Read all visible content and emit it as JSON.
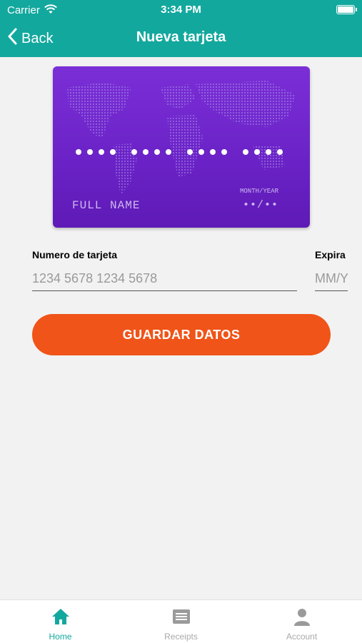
{
  "status": {
    "carrier": "Carrier",
    "time": "3:34 PM"
  },
  "nav": {
    "back_label": "Back",
    "title": "Nueva tarjeta"
  },
  "card": {
    "number_masked": [
      "●●●●",
      "●●●●",
      "●●●●",
      "●●●●"
    ],
    "full_name": "FULL NAME",
    "expiry_label": "MONTH/YEAR",
    "expiry_value": "••/••",
    "color_top": "#7a2fd6",
    "color_bottom": "#5e1ab6"
  },
  "form": {
    "number_label": "Numero de tarjeta",
    "number_placeholder": "1234 5678 1234 5678",
    "expiry_label": "Expira",
    "expiry_placeholder": "MM/YY"
  },
  "save_button": {
    "label": "GUARDAR DATOS",
    "color": "#f05418"
  },
  "tabbar": {
    "accent": "#13a89e",
    "tabs": [
      {
        "label": "Home",
        "icon": "home-icon",
        "active": true
      },
      {
        "label": "Receipts",
        "icon": "receipts-icon",
        "active": false
      },
      {
        "label": "Account",
        "icon": "account-icon",
        "active": false
      }
    ]
  }
}
